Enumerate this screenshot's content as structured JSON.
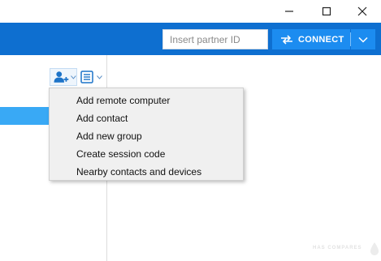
{
  "window": {
    "minimize_icon": "minimize-icon",
    "maximize_icon": "maximize-icon",
    "close_icon": "close-icon"
  },
  "header": {
    "partner_id_placeholder": "Insert partner ID",
    "partner_id_value": "",
    "connect_label": "CONNECT",
    "connect_icon": "swap-arrows-icon",
    "dropdown_icon": "chevron-down-icon",
    "accent_color": "#0e6fd0",
    "button_color": "#1c8cf0"
  },
  "toolbar": {
    "add_contact_icon": "add-person-icon",
    "list_view_icon": "list-icon"
  },
  "context_menu": {
    "items": [
      {
        "label": "Add remote computer"
      },
      {
        "label": "Add contact"
      },
      {
        "label": "Add new group"
      },
      {
        "label": "Create session code"
      },
      {
        "label": "Nearby contacts and devices"
      }
    ]
  },
  "list": {
    "selected_color": "#39a9f5"
  },
  "watermark": {
    "text": "HAS COMPARES"
  }
}
